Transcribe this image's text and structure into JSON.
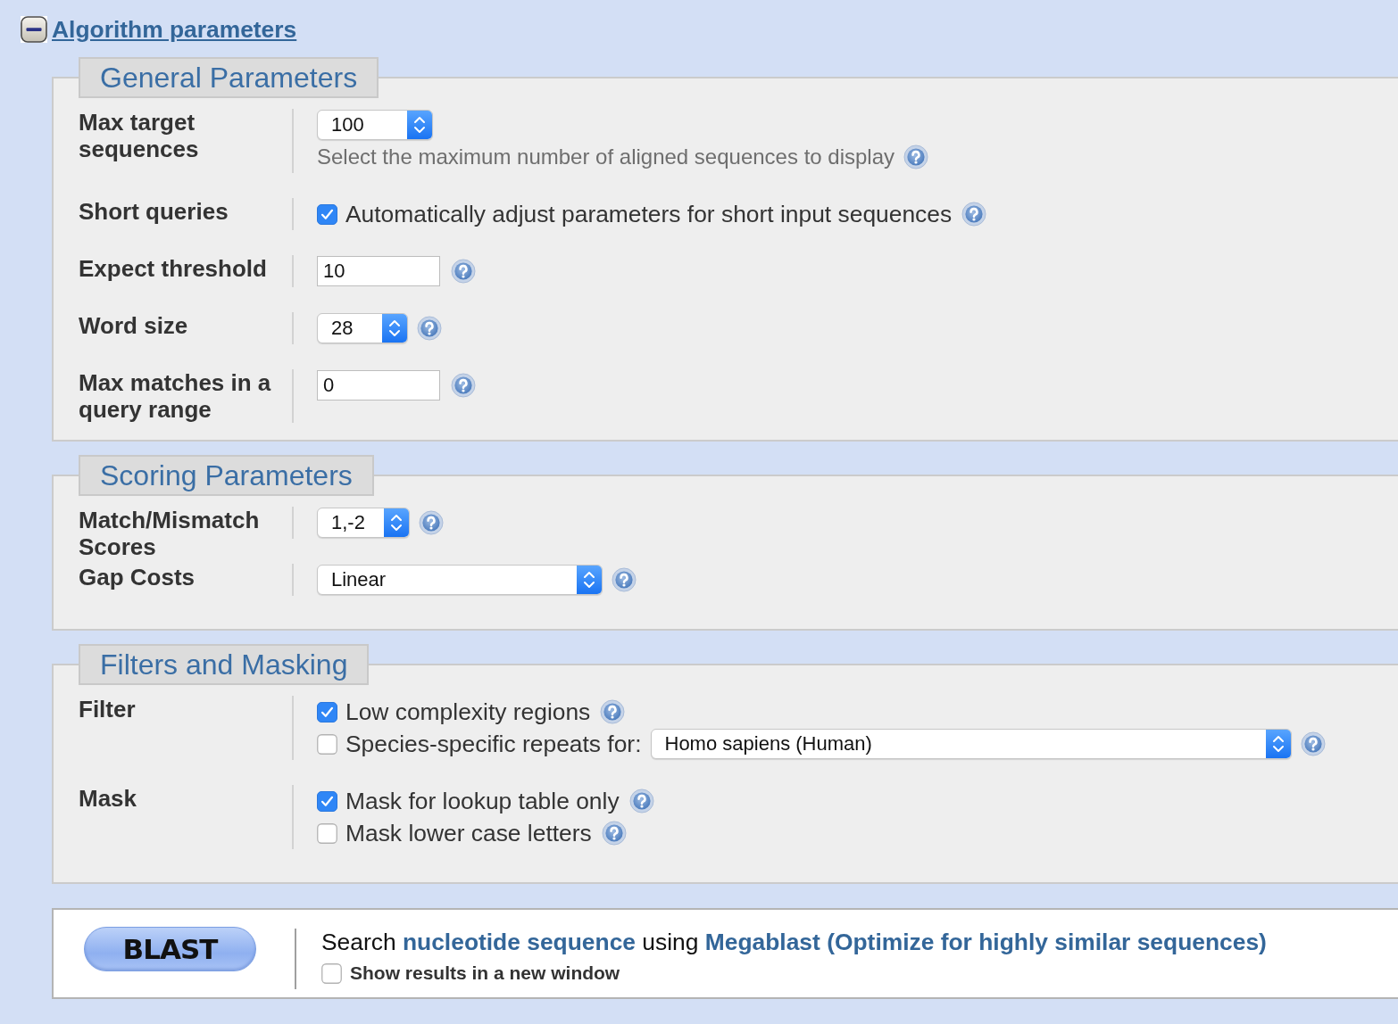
{
  "section": {
    "title": "Algorithm parameters",
    "expanded": true
  },
  "groups": [
    {
      "legend": "General Parameters",
      "rows": [
        {
          "label": "Max target sequences",
          "lines": [
            [
              {
                "kind": "select",
                "value": "100"
              }
            ],
            [
              {
                "kind": "note",
                "text": "Select the maximum number of aligned sequences to display"
              },
              {
                "kind": "help"
              }
            ]
          ]
        },
        {
          "label": "Short queries",
          "lines": [
            [
              {
                "kind": "checkbox",
                "label": "Automatically adjust parameters for short input sequences",
                "checked": true
              },
              {
                "kind": "help"
              }
            ]
          ]
        },
        {
          "label": "Expect threshold",
          "lines": [
            [
              {
                "kind": "input",
                "value": "10"
              },
              {
                "kind": "help"
              }
            ]
          ]
        },
        {
          "label": "Word size",
          "lines": [
            [
              {
                "kind": "select",
                "value": "28"
              },
              {
                "kind": "help"
              }
            ]
          ]
        },
        {
          "label": "Max matches in a query range",
          "lines": [
            [
              {
                "kind": "input",
                "value": "0"
              },
              {
                "kind": "help"
              }
            ]
          ]
        }
      ]
    },
    {
      "legend": "Scoring Parameters",
      "rows": [
        {
          "label": "Match/Mismatch Scores",
          "lines": [
            [
              {
                "kind": "select",
                "value": "1,-2"
              },
              {
                "kind": "help"
              }
            ]
          ]
        },
        {
          "label": "Gap Costs",
          "lines": [
            [
              {
                "kind": "select",
                "value": "Linear"
              },
              {
                "kind": "help"
              }
            ]
          ]
        }
      ]
    },
    {
      "legend": "Filters and Masking",
      "rows": [
        {
          "label": "Filter",
          "lines": [
            [
              {
                "kind": "checkbox",
                "label": "Low complexity regions",
                "checked": true
              },
              {
                "kind": "help"
              }
            ],
            [
              {
                "kind": "checkbox",
                "label": "Species-specific repeats for:",
                "checked": false
              },
              {
                "kind": "select",
                "value": "Homo sapiens (Human)"
              },
              {
                "kind": "help"
              }
            ]
          ]
        },
        {
          "label": "Mask",
          "lines": [
            [
              {
                "kind": "checkbox",
                "label": "Mask for lookup table only",
                "checked": true
              },
              {
                "kind": "help"
              }
            ],
            [
              {
                "kind": "checkbox",
                "label": "Mask lower case letters",
                "checked": false
              },
              {
                "kind": "help"
              }
            ]
          ]
        }
      ]
    }
  ],
  "submit": {
    "button": "BLAST",
    "summary": "Search **nucleotide sequence** using **Megablast (Optimize for highly similar sequences)**",
    "new_window": {
      "label": "Show results in a new window",
      "checked": false
    }
  }
}
